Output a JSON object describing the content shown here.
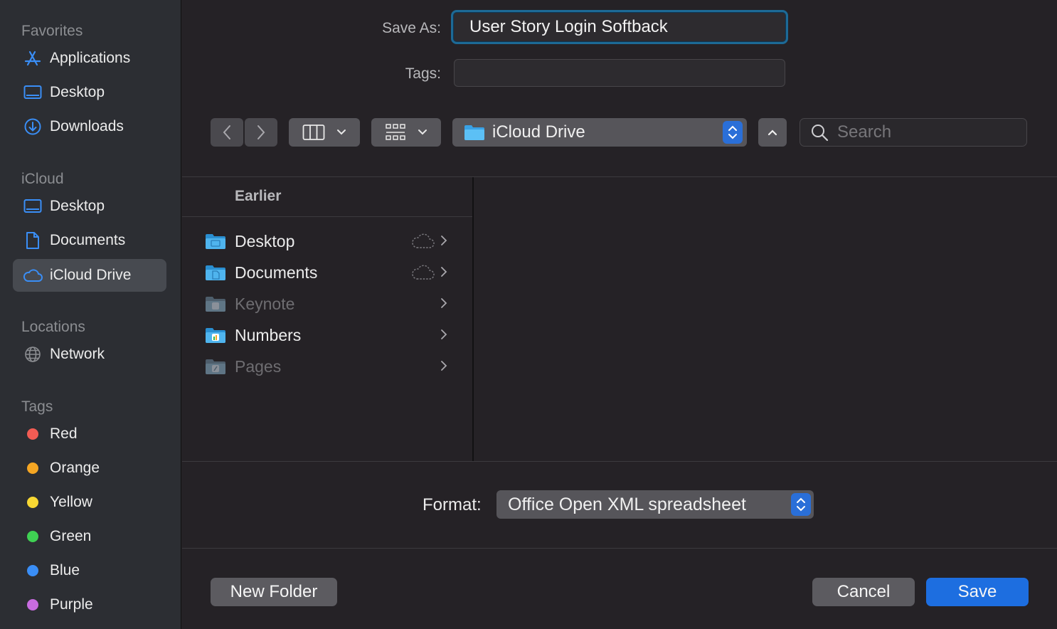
{
  "sidebar": {
    "favorites": {
      "header": "Favorites",
      "items": [
        {
          "label": "Applications",
          "icon": "applications-icon"
        },
        {
          "label": "Desktop",
          "icon": "desktop-icon"
        },
        {
          "label": "Downloads",
          "icon": "downloads-icon"
        }
      ]
    },
    "icloud": {
      "header": "iCloud",
      "items": [
        {
          "label": "Desktop",
          "icon": "desktop-icon"
        },
        {
          "label": "Documents",
          "icon": "document-icon"
        },
        {
          "label": "iCloud Drive",
          "icon": "cloud-icon",
          "selected": true
        }
      ]
    },
    "locations": {
      "header": "Locations",
      "items": [
        {
          "label": "Network",
          "icon": "globe-icon"
        }
      ]
    },
    "tags": {
      "header": "Tags",
      "items": [
        {
          "label": "Red",
          "color": "#f25c54"
        },
        {
          "label": "Orange",
          "color": "#f5a623"
        },
        {
          "label": "Yellow",
          "color": "#f8d833"
        },
        {
          "label": "Green",
          "color": "#3fd153"
        },
        {
          "label": "Blue",
          "color": "#3a8ef6"
        },
        {
          "label": "Purple",
          "color": "#c86ce0"
        }
      ]
    }
  },
  "form": {
    "save_as_label": "Save As:",
    "save_as_value": "User Story Login Softback",
    "tags_label": "Tags:",
    "tags_value": ""
  },
  "toolbar": {
    "location": "iCloud Drive",
    "search_placeholder": "Search"
  },
  "browser": {
    "section_header": "Earlier",
    "items": [
      {
        "name": "Desktop",
        "enabled": true,
        "cloud": true
      },
      {
        "name": "Documents",
        "enabled": true,
        "cloud": true
      },
      {
        "name": "Keynote",
        "enabled": false,
        "cloud": false
      },
      {
        "name": "Numbers",
        "enabled": true,
        "cloud": false
      },
      {
        "name": "Pages",
        "enabled": false,
        "cloud": false
      }
    ]
  },
  "format": {
    "label": "Format:",
    "value": "Office Open XML spreadsheet"
  },
  "buttons": {
    "new_folder": "New Folder",
    "cancel": "Cancel",
    "save": "Save"
  },
  "colors": {
    "accent": "#1d6ee0",
    "focus_ring": "#1d6a96"
  }
}
